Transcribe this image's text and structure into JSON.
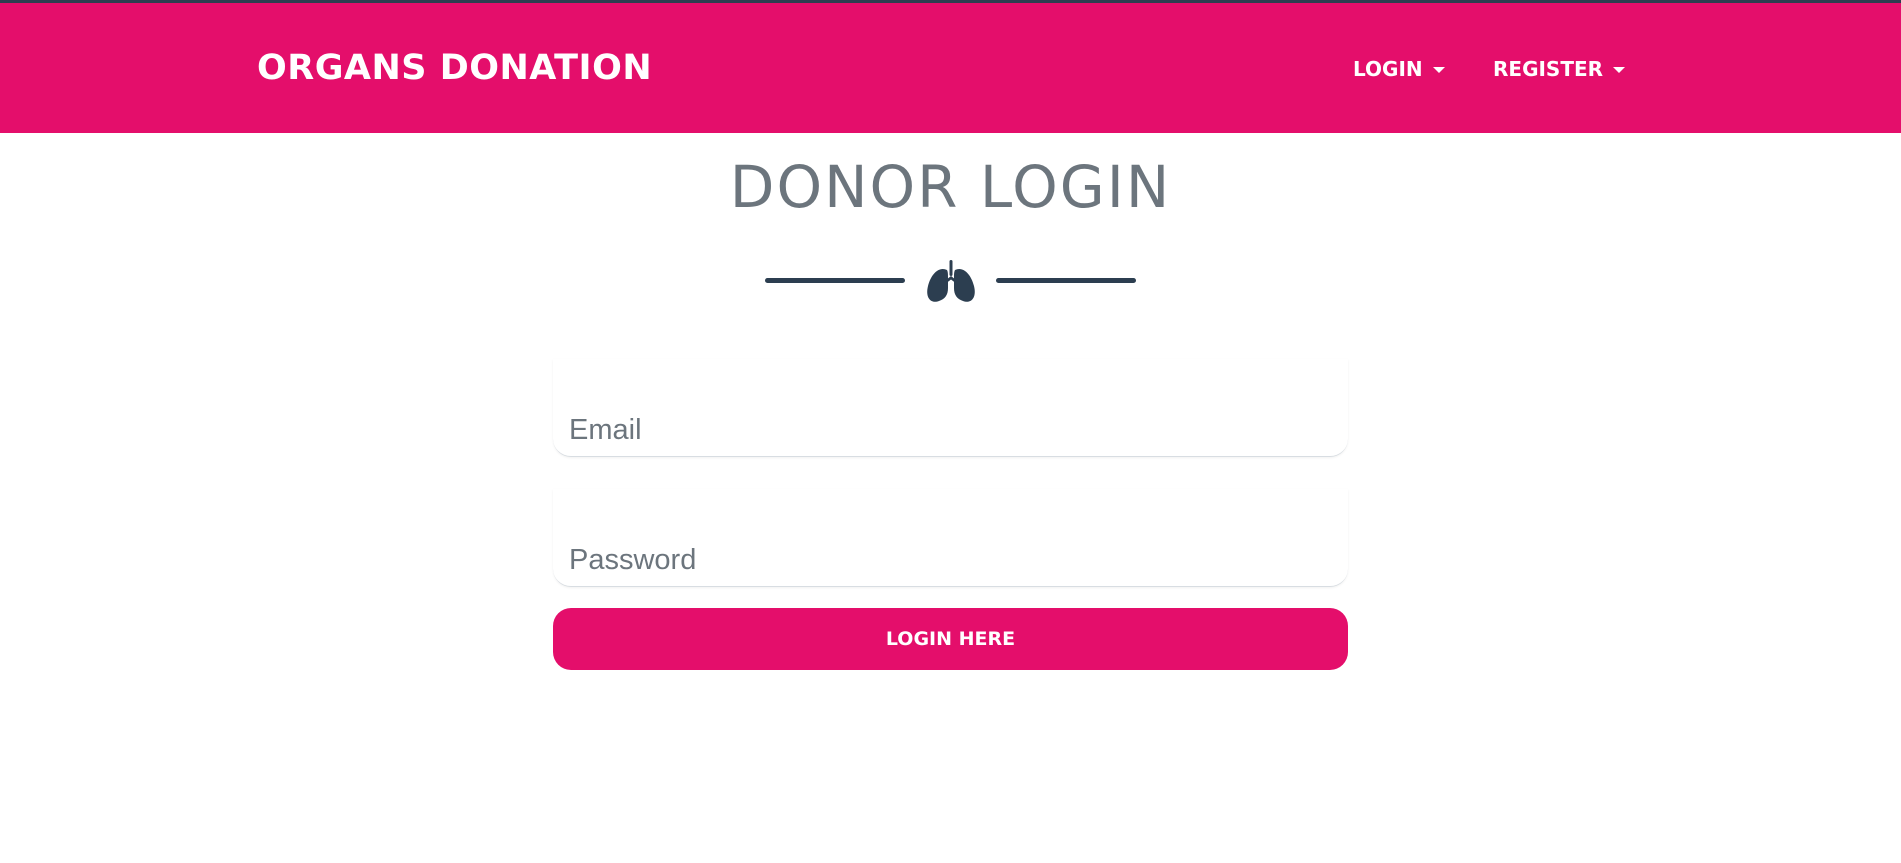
{
  "colors": {
    "brand_pink": "#e40e6b",
    "title_gray": "#6c757d",
    "divider_navy": "#2c3e50"
  },
  "navbar": {
    "brand": "ORGANS DONATION",
    "items": [
      {
        "label": "LOGIN",
        "icon": "caret-down-icon"
      },
      {
        "label": "REGISTER",
        "icon": "caret-down-icon"
      }
    ]
  },
  "main": {
    "title": "DONOR LOGIN",
    "divider_icon": "lungs-icon",
    "form": {
      "email": {
        "placeholder": "Email",
        "value": ""
      },
      "password": {
        "placeholder": "Password",
        "value": ""
      },
      "submit_label": "LOGIN HERE"
    }
  }
}
